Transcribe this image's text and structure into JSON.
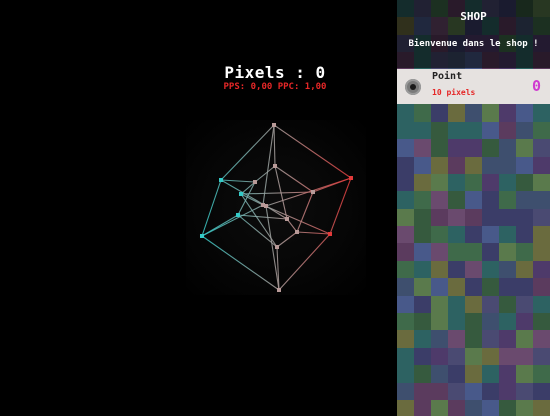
{
  "stats": {
    "pixels_label": "Pixels : 0",
    "rates_label": "PPS: 0,00  PPC: 1,00"
  },
  "shop": {
    "title": "SHOP",
    "welcome": "Bienvenue dans le shop !",
    "items": [
      {
        "name": "Point",
        "price": "10 pixels",
        "owned": "0",
        "icon": "point-icon"
      }
    ]
  },
  "colors": {
    "background": "#000000",
    "rates_text": "#e52727",
    "owned_count": "#d03ad0",
    "cube_left": "#34cbc8",
    "cube_right": "#e23a3a",
    "item_background": "#e6e2e0"
  },
  "shop_tile_palette": [
    "#3b3d68",
    "#3f6a4a",
    "#5b3b5e",
    "#48598a",
    "#6a6b3e",
    "#2d6262",
    "#4a4a72",
    "#5a7a4c",
    "#3e4f6e",
    "#6a4a6e",
    "#365a3e",
    "#4e3a6a"
  ]
}
